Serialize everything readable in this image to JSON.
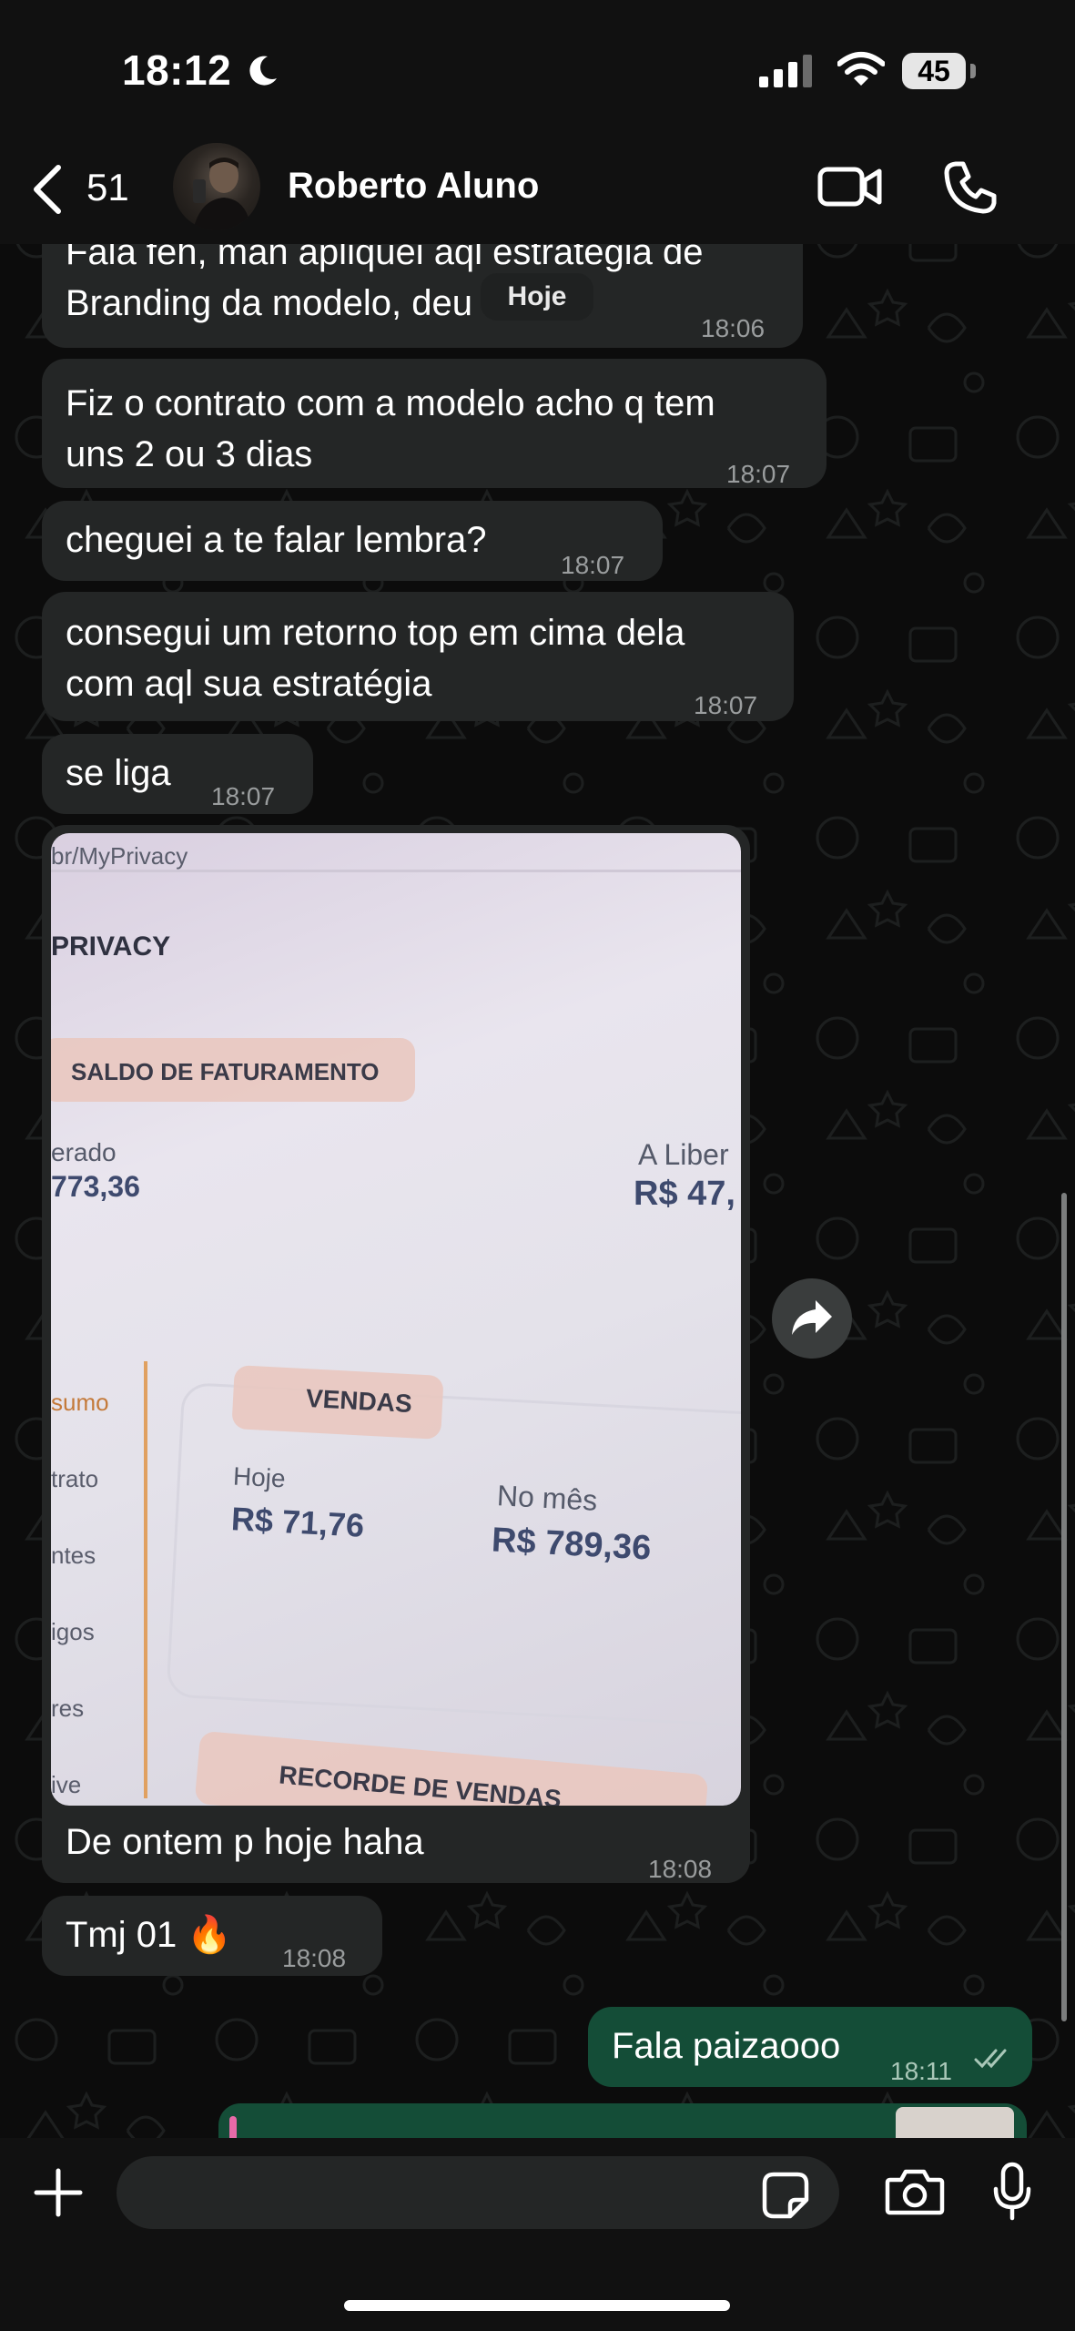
{
  "status": {
    "time": "18:12",
    "battery": "45"
  },
  "header": {
    "back_count": "51",
    "contact_name": "Roberto Aluno"
  },
  "date_divider": "Hoje",
  "messages": [
    {
      "text_line1": "Fala feh, man apliquei aql estratégia de",
      "text_line2": "Branding da modelo, deu bom",
      "time": "18:06"
    },
    {
      "text_line1": "Fiz o contrato com a modelo acho q tem",
      "text_line2": "uns 2 ou 3 dias",
      "time": "18:07"
    },
    {
      "text_line1": "cheguei a te falar lembra?",
      "time": "18:07"
    },
    {
      "text_line1": "consegui um retorno top em cima dela",
      "text_line2": "com aql sua estratégia",
      "time": "18:07"
    },
    {
      "text_line1": "se liga",
      "time": "18:07"
    },
    {
      "caption": "De ontem p hoje haha",
      "time": "18:08"
    },
    {
      "text_line1": "Tmj 01 🔥",
      "time": "18:08"
    },
    {
      "text_line1": "Fala paizaooo",
      "time": "18:11",
      "outgoing": true,
      "status": "read"
    }
  ],
  "photo": {
    "url_fragment": "br/MyPrivacy",
    "brand": "PRIVACY",
    "balance_label": "SALDO DE FATURAMENTO",
    "left_label": "erado",
    "left_value": "773,36",
    "right_label": "A Liber",
    "right_value": "R$ 47,",
    "side_menu": [
      "sumo",
      "trato",
      "ntes",
      "igos",
      "res",
      "ive"
    ],
    "sales_label": "VENDAS",
    "today_label": "Hoje",
    "today_value": "R$ 71,76",
    "month_label": "No mês",
    "month_value": "R$ 789,36",
    "record_label": "RECORDE DE VENDAS"
  },
  "composer": {
    "placeholder": ""
  },
  "colors": {
    "incoming_bubble": "#242626",
    "outgoing_bubble": "#144d37",
    "background": "#0b0b0b"
  }
}
